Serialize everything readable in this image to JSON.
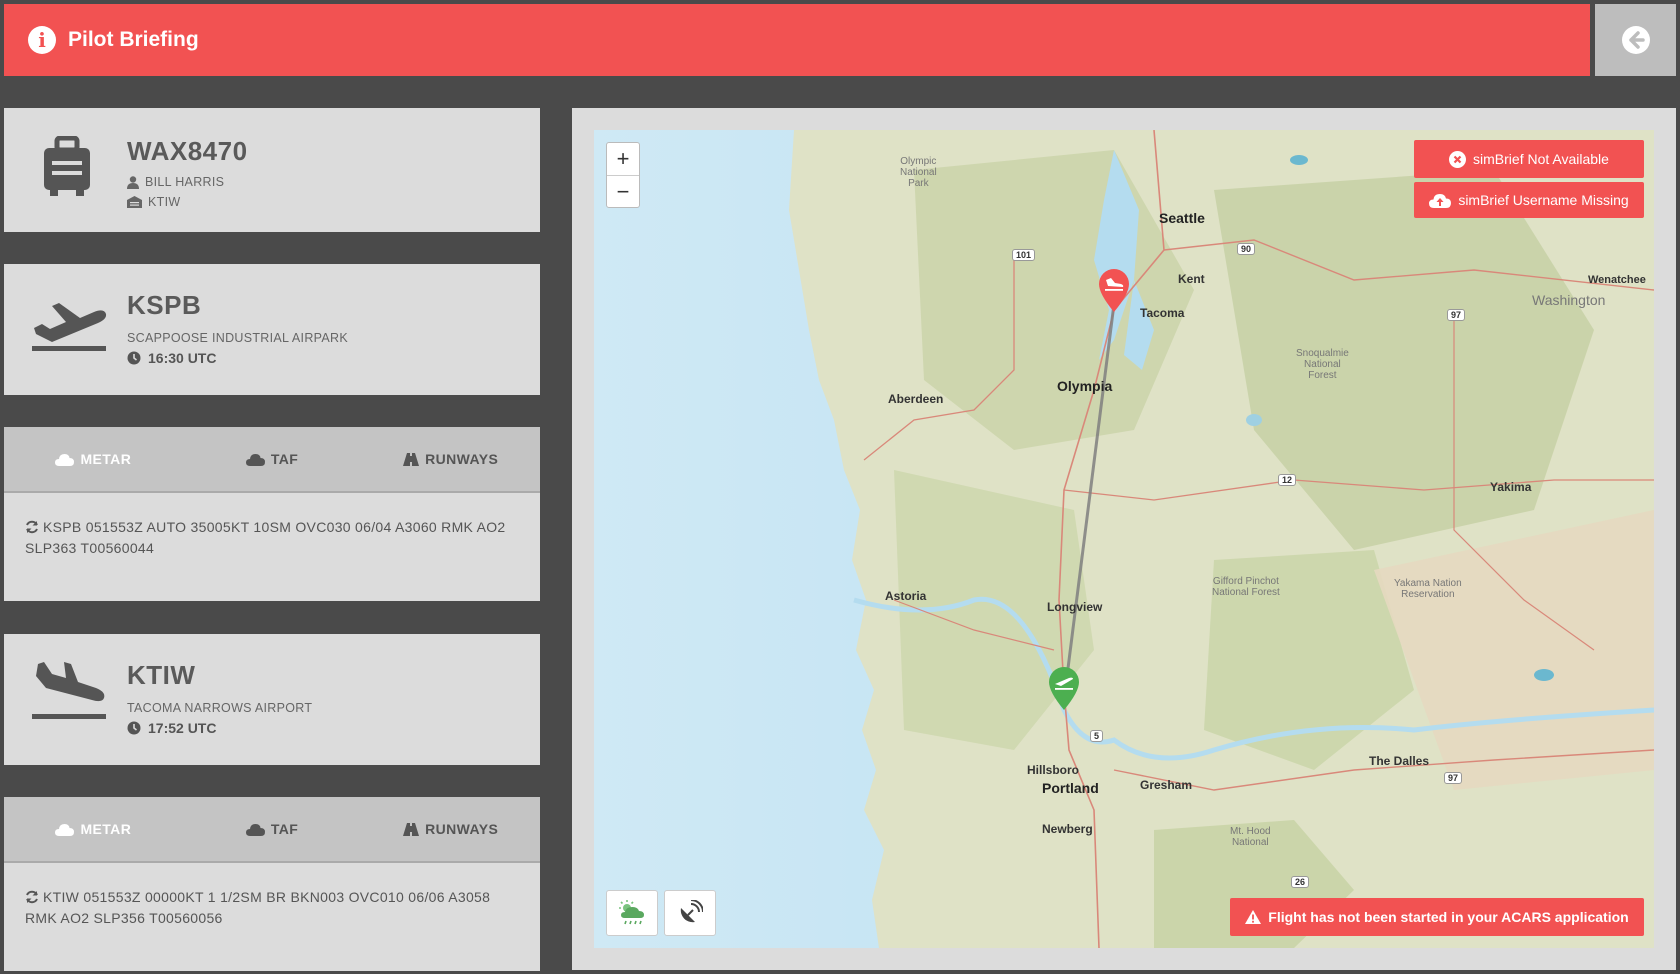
{
  "header": {
    "title": "Pilot Briefing"
  },
  "flight": {
    "callsign": "WAX8470",
    "pilot": "BILL HARRIS",
    "destination": "KTIW"
  },
  "departure": {
    "icao": "KSPB",
    "name": "SCAPPOOSE INDUSTRIAL AIRPARK",
    "time": "16:30 UTC"
  },
  "arrival": {
    "icao": "KTIW",
    "name": "TACOMA NARROWS AIRPORT",
    "time": "17:52 UTC"
  },
  "tabs": {
    "metar": "METAR",
    "taf": "TAF",
    "runways": "RUNWAYS"
  },
  "departure_weather": {
    "metar": "KSPB 051553Z AUTO 35005KT 10SM OVC030 06/04 A3060 RMK AO2 SLP363 T00560044"
  },
  "arrival_weather": {
    "metar": "KTIW 051553Z 00000KT 1 1/2SM BR BKN003 OVC010 06/06 A3058 RMK AO2 SLP356 T00560056"
  },
  "map": {
    "zoom_in": "+",
    "zoom_out": "−",
    "simbrief_not_available": "simBrief Not Available",
    "simbrief_username_missing": "simBrief Username Missing",
    "acars_warning": "Flight has not been started in your ACARS application",
    "labels": {
      "seattle": "Seattle",
      "kent": "Kent",
      "tacoma": "Tacoma",
      "olympia": "Olympia",
      "aberdeen": "Aberdeen",
      "astoria": "Astoria",
      "longview": "Longview",
      "hillsboro": "Hillsboro",
      "portland": "Portland",
      "gresham": "Gresham",
      "newberg": "Newberg",
      "the_dalles": "The Dalles",
      "yakima": "Yakima",
      "wenatchee": "Wenatchee",
      "washington": "Washington",
      "olympic_park": "Olympic\nNational\nPark",
      "snoqualmie": "Snoqualmie\nNational\nForest",
      "gifford": "Gifford Pinchot\nNational Forest",
      "yakama": "Yakama Nation\nReservation",
      "mt_hood": "Mt. Hood\nNational"
    },
    "shields": {
      "us101": "101",
      "i90": "90",
      "us97a": "97",
      "us12": "12",
      "i5": "5",
      "us97b": "97",
      "i26": "26"
    }
  },
  "colors": {
    "accent": "#f25252",
    "panel": "#dcdcdc",
    "background": "#4a4a4a",
    "arrival_marker": "#f25252",
    "departure_marker": "#4caf50"
  }
}
